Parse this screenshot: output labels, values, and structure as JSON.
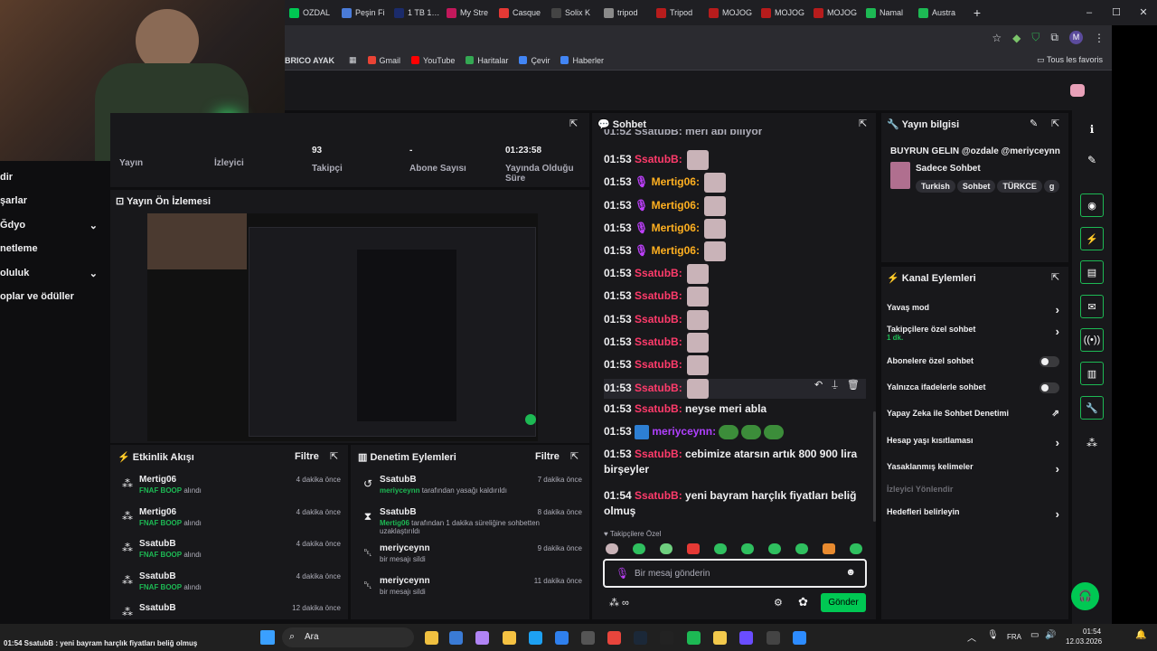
{
  "browser": {
    "tabs": [
      {
        "label": "OZDAL",
        "color": "#00c853"
      },
      {
        "label": "Peşin Fi",
        "color": "#4a7bd8"
      },
      {
        "label": "1 TB 1…",
        "color": "#1b2b6b"
      },
      {
        "label": "My Stre",
        "color": "#c2185b"
      },
      {
        "label": "Casque",
        "color": "#e53935"
      },
      {
        "label": "Solix K",
        "color": "#444444"
      },
      {
        "label": "tripod",
        "color": "#8a8a8a"
      },
      {
        "label": "Tripod",
        "color": "#b71c1c"
      },
      {
        "label": "MOJOG",
        "color": "#b71c1c"
      },
      {
        "label": "MOJOG",
        "color": "#b71c1c"
      },
      {
        "label": "MOJOG",
        "color": "#b71c1c"
      },
      {
        "label": "Namal",
        "color": "#1db954"
      },
      {
        "label": "Austra",
        "color": "#1db954"
      }
    ],
    "new_tab": "+",
    "win_controls": [
      "–",
      "☐",
      "✕"
    ],
    "bookmarks": [
      {
        "label": "BRICO AYAK",
        "color": "#7b1fa2"
      },
      {
        "label": "Gmail",
        "color": "#ea4335"
      },
      {
        "label": "YouTube",
        "color": "#ff0000"
      },
      {
        "label": "Haritalar",
        "color": "#34a853"
      },
      {
        "label": "Çevir",
        "color": "#4285f4"
      },
      {
        "label": "Haberler",
        "color": "#4285f4"
      }
    ],
    "all_bookmarks": "Tous les favoris",
    "profile_initial": "M"
  },
  "sidebar": {
    "items": [
      {
        "label": "dir",
        "chev": ""
      },
      {
        "label": "şarlar",
        "chev": ""
      },
      {
        "label": "Ğdyo",
        "chev": "⌄"
      },
      {
        "label": "netleme",
        "chev": ""
      },
      {
        "label": "oluluk",
        "chev": "⌄"
      },
      {
        "label": "oplar ve ödüller",
        "chev": ""
      }
    ]
  },
  "stats": [
    {
      "value": "",
      "label": "Yayın"
    },
    {
      "value": "",
      "label": "İzleyici"
    },
    {
      "value": "93",
      "label": "Takipçi"
    },
    {
      "value": "-",
      "label": "Abone Sayısı"
    },
    {
      "value": "01:23:58",
      "label": "Yayında Olduğu Süre"
    }
  ],
  "preview": {
    "title": "Yayın Ön İzlemesi"
  },
  "activity": {
    "title": "Etkinlik Akışı",
    "filter": "Filtre",
    "items": [
      {
        "name": "Mertig06",
        "reward": "FNAF BOOP",
        "suffix": " alındı",
        "time": "4 dakika önce"
      },
      {
        "name": "Mertig06",
        "reward": "FNAF BOOP",
        "suffix": " alındı",
        "time": "4 dakika önce"
      },
      {
        "name": "SsatubB",
        "reward": "FNAF BOOP",
        "suffix": " alındı",
        "time": "4 dakika önce"
      },
      {
        "name": "SsatubB",
        "reward": "FNAF BOOP",
        "suffix": " alındı",
        "time": "4 dakika önce"
      },
      {
        "name": "SsatubB",
        "reward": "",
        "suffix": "",
        "time": "12 dakika önce"
      }
    ]
  },
  "moderation": {
    "title": "Denetim Eylemleri",
    "filter": "Filtre",
    "items": [
      {
        "icon": "↺",
        "name": "SsatubB",
        "actor": "meriyceynn",
        "text": " tarafından yasağı kaldırıldı",
        "text2": "",
        "time": "7 dakika önce"
      },
      {
        "icon": "⧗",
        "name": "SsatubB",
        "actor": "Mertig06",
        "text": " tarafından 1 dakika süreliğine sohbetten",
        "text2": "uzaklaştırıldı",
        "time": "8 dakika önce"
      },
      {
        "icon": "␡",
        "name": "meriyceynn",
        "actor": "",
        "text": "bir mesajı sildi",
        "text2": "",
        "time": "9 dakika önce"
      },
      {
        "icon": "␡",
        "name": "meriyceynn",
        "actor": "",
        "text": "bir mesajı sildi",
        "text2": "",
        "time": "11 dakika önce"
      }
    ]
  },
  "chat": {
    "title": "Sohbet",
    "partial_top": "01:52 SsatubB: meri abi biliyor",
    "messages": [
      {
        "time": "01:53",
        "user": "SsatubB:",
        "color": "#ff3b6b",
        "badge": "",
        "text": "",
        "emotes": 1,
        "frogs": 0
      },
      {
        "time": "01:53",
        "user": "Mertig06:",
        "color": "#ffb020",
        "badge": "mic",
        "text": "",
        "emotes": 1,
        "frogs": 0
      },
      {
        "time": "01:53",
        "user": "Mertig06:",
        "color": "#ffb020",
        "badge": "mic",
        "text": "",
        "emotes": 1,
        "frogs": 0
      },
      {
        "time": "01:53",
        "user": "Mertig06:",
        "color": "#ffb020",
        "badge": "mic",
        "text": "",
        "emotes": 1,
        "frogs": 0
      },
      {
        "time": "01:53",
        "user": "Mertig06:",
        "color": "#ffb020",
        "badge": "mic",
        "text": "",
        "emotes": 1,
        "frogs": 0
      },
      {
        "time": "01:53",
        "user": "SsatubB:",
        "color": "#ff3b6b",
        "badge": "",
        "text": "",
        "emotes": 1,
        "frogs": 0
      },
      {
        "time": "01:53",
        "user": "SsatubB:",
        "color": "#ff3b6b",
        "badge": "",
        "text": "",
        "emotes": 1,
        "frogs": 0
      },
      {
        "time": "01:53",
        "user": "SsatubB:",
        "color": "#ff3b6b",
        "badge": "",
        "text": "",
        "emotes": 1,
        "frogs": 0
      },
      {
        "time": "01:53",
        "user": "SsatubB:",
        "color": "#ff3b6b",
        "badge": "",
        "text": "",
        "emotes": 1,
        "frogs": 0
      },
      {
        "time": "01:53",
        "user": "SsatubB:",
        "color": "#ff3b6b",
        "badge": "",
        "text": "",
        "emotes": 1,
        "frogs": 0
      },
      {
        "time": "01:53",
        "user": "SsatubB:",
        "color": "#ff3b6b",
        "badge": "",
        "text": "",
        "emotes": 1,
        "frogs": 0
      },
      {
        "time": "01:53",
        "user": "SsatubB:",
        "color": "#ff3b6b",
        "badge": "",
        "text": " neyse meri abla",
        "emotes": 0,
        "frogs": 0
      },
      {
        "time": "01:53",
        "user": "meriyceynn:",
        "color": "#b040ff",
        "badge": "box",
        "text": "",
        "emotes": 0,
        "frogs": 3
      },
      {
        "time": "01:53",
        "user": "SsatubB:",
        "color": "#ff3b6b",
        "badge": "",
        "text": " cebimize atarsın artık 800 900 lira birşeyler",
        "emotes": 0,
        "frogs": 0
      },
      {
        "time": "01:54",
        "user": "SsatubB:",
        "color": "#ff3b6b",
        "badge": "",
        "text": " yeni bayram harçlık fiyatları beliğ olmuş",
        "emotes": 0,
        "frogs": 0
      }
    ],
    "followers_only": "Takipçilere Özel",
    "input_placeholder": "Bir mesaj gönderin",
    "send_label": "Gönder"
  },
  "stream_info": {
    "title": "Yayın bilgisi",
    "stream_title": "BUYRUN GELIN @ozdale @meriyceynn",
    "category": "Sadece Sohbet",
    "tags": [
      "Turkish",
      "Sohbet",
      "TÜRKCE",
      "g"
    ]
  },
  "channel_actions": {
    "title": "Kanal Eylemleri",
    "items": [
      {
        "label": "Yavaş mod",
        "sub": "",
        "control": "chevron",
        "muted": false
      },
      {
        "label": "Takipçilere özel sohbet",
        "sub": "1 dk.",
        "control": "chevron",
        "muted": false
      },
      {
        "label": "Abonelere özel sohbet",
        "sub": "",
        "control": "toggle",
        "muted": false
      },
      {
        "label": "Yalnızca ifadelerle sohbet",
        "sub": "",
        "control": "toggle",
        "muted": false
      },
      {
        "label": "Yapay Zeka ile Sohbet Denetimi",
        "sub": "",
        "control": "external",
        "muted": false
      },
      {
        "label": "Hesap yaşı kısıtlaması",
        "sub": "",
        "control": "chevron",
        "muted": false
      },
      {
        "label": "Yasaklanmış kelimeler",
        "sub": "",
        "control": "chevron",
        "muted": false
      },
      {
        "label": "İzleyici Yönlendir",
        "sub": "",
        "control": "none",
        "muted": true
      },
      {
        "label": "Hedefleri belirleyin",
        "sub": "",
        "control": "chevron",
        "muted": false
      }
    ]
  },
  "rail_icons": [
    "info-icon",
    "pencil-icon",
    "camera-icon",
    "bolt-icon",
    "doc-icon",
    "chat-icon",
    "broadcast-icon",
    "layout-icon",
    "wrench-icon",
    "nodes-icon"
  ],
  "taskbar": {
    "search_placeholder": "Ara",
    "notification": "01:54  SsatubB : yeni bayram harçlık fiyatları beliğ olmuş",
    "lang": "FRA",
    "time": "01:54",
    "date": "12.03.2026"
  }
}
